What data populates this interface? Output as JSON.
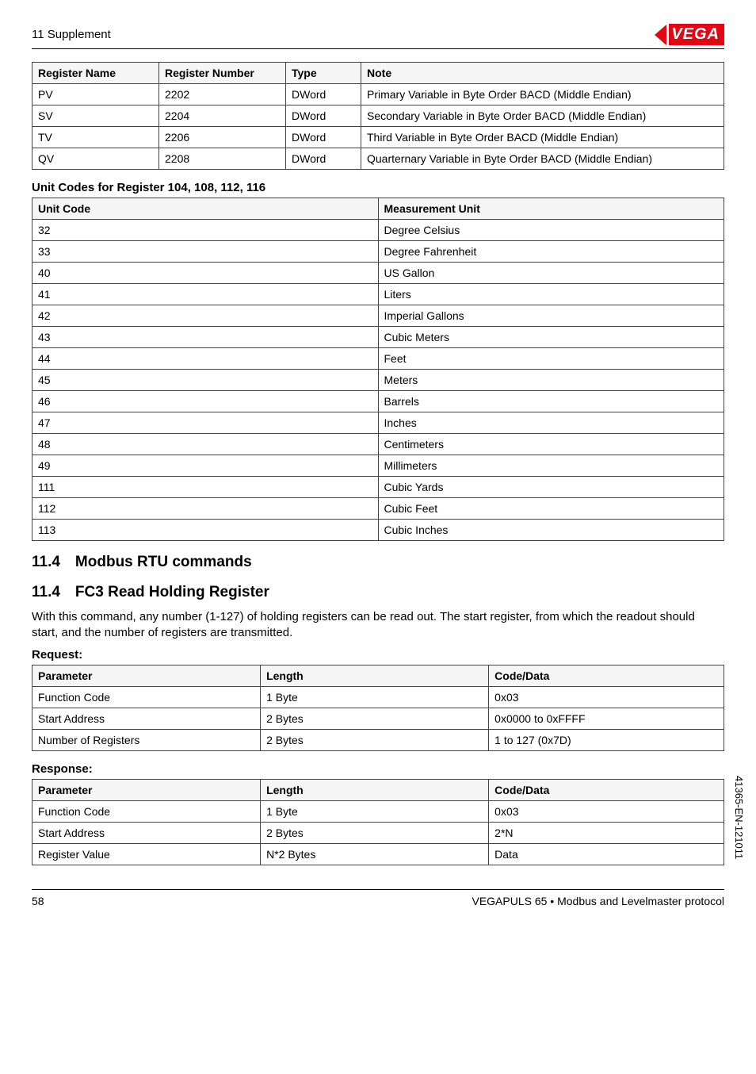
{
  "header": {
    "section": "11 Supplement",
    "logo": "VEGA"
  },
  "table1": {
    "headers": [
      "Register Name",
      "Register Number",
      "Type",
      "Note"
    ],
    "rows": [
      [
        "PV",
        "2202",
        "DWord",
        "Primary Variable in Byte Order BACD (Middle Endian)"
      ],
      [
        "SV",
        "2204",
        "DWord",
        "Secondary Variable in Byte Order BACD (Middle Endian)"
      ],
      [
        "TV",
        "2206",
        "DWord",
        "Third Variable in Byte Order BACD (Middle Endian)"
      ],
      [
        "QV",
        "2208",
        "DWord",
        "Quarternary Variable in Byte Order BACD (Middle Endian)"
      ]
    ]
  },
  "unitCodesTitle": "Unit Codes for Register 104, 108, 112, 116",
  "table2": {
    "headers": [
      "Unit Code",
      "Measurement Unit"
    ],
    "rows": [
      [
        "32",
        "Degree Celsius"
      ],
      [
        "33",
        "Degree Fahrenheit"
      ],
      [
        "40",
        "US Gallon"
      ],
      [
        "41",
        "Liters"
      ],
      [
        "42",
        "Imperial Gallons"
      ],
      [
        "43",
        "Cubic Meters"
      ],
      [
        "44",
        "Feet"
      ],
      [
        "45",
        "Meters"
      ],
      [
        "46",
        "Barrels"
      ],
      [
        "47",
        "Inches"
      ],
      [
        "48",
        "Centimeters"
      ],
      [
        "49",
        "Millimeters"
      ],
      [
        "111",
        "Cubic Yards"
      ],
      [
        "112",
        "Cubic Feet"
      ],
      [
        "113",
        "Cubic Inches"
      ]
    ]
  },
  "h114": "11.4 Modbus RTU commands",
  "h114b": "11.4 FC3 Read Holding Register",
  "para": "With this command, any number (1-127) of holding registers can be read out. The start register, from which the readout should start, and the number of registers are transmitted.",
  "requestTitle": "Request:",
  "table3": {
    "headers": [
      "Parameter",
      "Length",
      "Code/Data"
    ],
    "rows": [
      [
        "Function Code",
        "1 Byte",
        "0x03"
      ],
      [
        "Start Address",
        "2 Bytes",
        "0x0000 to 0xFFFF"
      ],
      [
        "Number of Registers",
        "2 Bytes",
        "1 to 127 (0x7D)"
      ]
    ]
  },
  "responseTitle": "Response:",
  "table4": {
    "headers": [
      "Parameter",
      "Length",
      "Code/Data"
    ],
    "rows": [
      [
        "Function Code",
        "1 Byte",
        "0x03"
      ],
      [
        "Start Address",
        "2 Bytes",
        "2*N"
      ],
      [
        "Register Value",
        "N*2 Bytes",
        "Data"
      ]
    ]
  },
  "footer": {
    "page": "58",
    "docline": "VEGAPULS 65 • Modbus and Levelmaster protocol"
  },
  "sideText": "41365-EN-121011"
}
